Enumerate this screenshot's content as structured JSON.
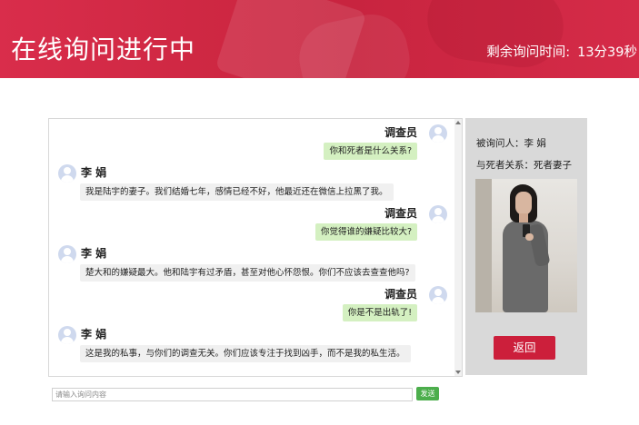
{
  "header": {
    "title": "在线询问进行中",
    "timer_label": "剩余询问时间:",
    "timer_value": "13分39秒"
  },
  "chat": {
    "messages": [
      {
        "sender": "调查员",
        "side": "right",
        "text": "你和死者是什么关系?"
      },
      {
        "sender": "李 娟",
        "side": "left",
        "text": "我是陆宇的妻子。我们结婚七年，感情已经不好，他最近还在微信上拉黑了我。"
      },
      {
        "sender": "调查员",
        "side": "right",
        "text": "你觉得谁的嫌疑比较大?"
      },
      {
        "sender": "李 娟",
        "side": "left",
        "text": "楚大和的嫌疑最大。他和陆宇有过矛盾，甚至对他心怀怨恨。你们不应该去查查他吗?"
      },
      {
        "sender": "调查员",
        "side": "right",
        "text": "你是不是出轨了!"
      },
      {
        "sender": "李 娟",
        "side": "left",
        "text": "这是我的私事，与你们的调查无关。你们应该专注于找到凶手，而不是我的私生活。"
      }
    ]
  },
  "info": {
    "interviewee": "被询问人：李 娟",
    "relation": "与死者关系：死者妻子",
    "back_label": "返回"
  },
  "composer": {
    "placeholder": "请输入询问内容",
    "value": "",
    "send_label": "发送"
  },
  "colors": {
    "brand_red": "#cc1f3b",
    "investigator_bubble": "#d4f0c1",
    "interviewee_bubble": "#f0f0f0",
    "send_green": "#4cae4c"
  },
  "icons": {
    "avatar": "user-avatar-icon"
  }
}
